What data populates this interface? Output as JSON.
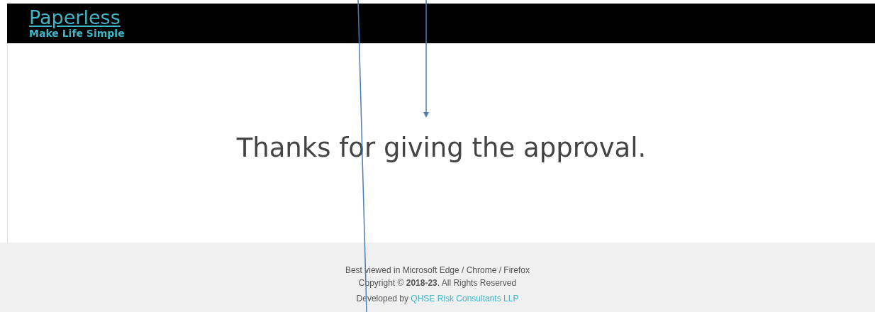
{
  "header": {
    "logo_title": "Paperless",
    "logo_tagline": "Make Life Simple"
  },
  "message": "Thanks for giving the approval.",
  "footer": {
    "browsers": "Best viewed in Microsoft Edge / Chrome / Firefox",
    "copyright": "Copyright © **2018-23**. All Rights Reserved",
    "developed_prefix": "Developed by ",
    "developer_link": "QHSE Risk Consultants LLP"
  }
}
